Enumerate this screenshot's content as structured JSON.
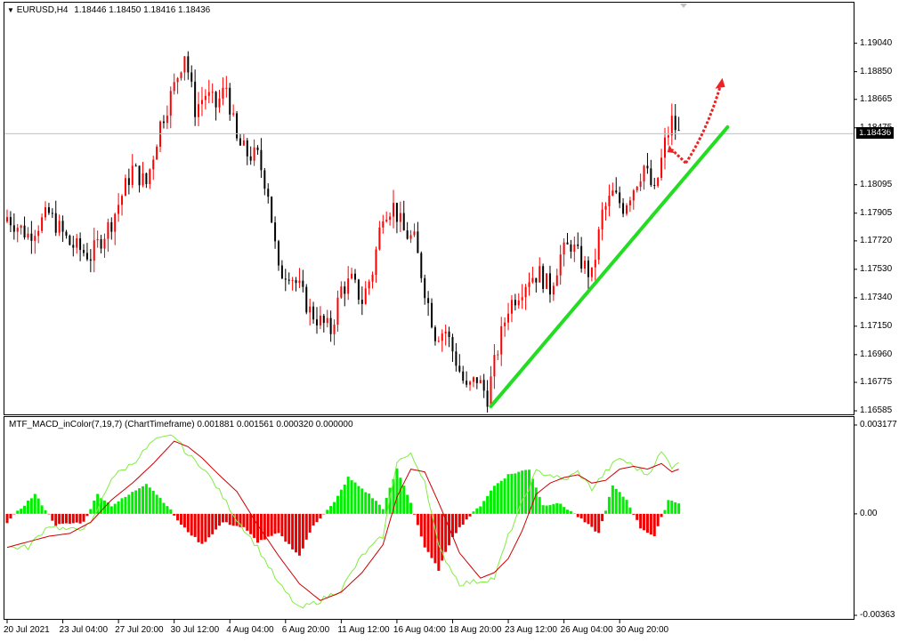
{
  "header": {
    "symbol": "EURUSD,H4",
    "ohlc": "1.18446 1.18450 1.18416 1.18436"
  },
  "indicator": {
    "title": "MTF_MACD_inColor(7,19,7) (ChartTimeframe) 0.001881 0.001561 0.000320 0.000000"
  },
  "price_axis": [
    "1.19040",
    "1.18850",
    "1.18665",
    "1.18475",
    "1.18095",
    "1.17905",
    "1.17720",
    "1.17530",
    "1.17340",
    "1.17150",
    "1.16960",
    "1.16775",
    "1.16585"
  ],
  "current_price": "1.18436",
  "macd_axis": [
    "0.003177",
    "0.00",
    "-0.00363"
  ],
  "time_axis": [
    "20 Jul 2021",
    "23 Jul 04:00",
    "27 Jul 20:00",
    "30 Jul 12:00",
    "4 Aug 04:00",
    "6 Aug 20:00",
    "11 Aug 12:00",
    "16 Aug 04:00",
    "18 Aug 20:00",
    "23 Aug 12:00",
    "26 Aug 04:00",
    "30 Aug 20:00"
  ],
  "colors": {
    "bull": "#ff0000",
    "bear": "#000000",
    "trendline": "#22dd22",
    "hist_up": "#00ee00",
    "hist_down": "#ee0000",
    "macd_line": "#80ee40",
    "signal_line": "#cc0000",
    "projection": "#ee2222"
  },
  "chart_data": [
    {
      "type": "candlestick",
      "title": "EURUSD,H4",
      "ylim": [
        1.16585,
        1.1921
      ],
      "x": "bar index (H4 bars), time_axis gives tick labels every ~16 bars",
      "close_path": [
        [
          0,
          1.1788
        ],
        [
          6,
          1.1776
        ],
        [
          12,
          1.179
        ],
        [
          18,
          1.177
        ],
        [
          24,
          1.1762
        ],
        [
          30,
          1.1785
        ],
        [
          36,
          1.182
        ],
        [
          40,
          1.181
        ],
        [
          44,
          1.185
        ],
        [
          48,
          1.1875
        ],
        [
          51,
          1.1898
        ],
        [
          54,
          1.186
        ],
        [
          57,
          1.187
        ],
        [
          60,
          1.1862
        ],
        [
          63,
          1.1875
        ],
        [
          66,
          1.1838
        ],
        [
          69,
          1.183
        ],
        [
          72,
          1.1828
        ],
        [
          75,
          1.1805
        ],
        [
          78,
          1.175
        ],
        [
          81,
          1.1752
        ],
        [
          84,
          1.174
        ],
        [
          87,
          1.1725
        ],
        [
          90,
          1.1718
        ],
        [
          93,
          1.1712
        ],
        [
          96,
          1.174
        ],
        [
          99,
          1.1745
        ],
        [
          102,
          1.1732
        ],
        [
          105,
          1.1752
        ],
        [
          108,
          1.1792
        ],
        [
          111,
          1.1795
        ],
        [
          114,
          1.1778
        ],
        [
          117,
          1.1772
        ],
        [
          120,
          1.174
        ],
        [
          123,
          1.171
        ],
        [
          126,
          1.1712
        ],
        [
          129,
          1.1692
        ],
        [
          132,
          1.1672
        ],
        [
          135,
          1.168
        ],
        [
          138,
          1.1668
        ],
        [
          141,
          1.17
        ],
        [
          144,
          1.1728
        ],
        [
          147,
          1.1738
        ],
        [
          150,
          1.1748
        ],
        [
          153,
          1.175
        ],
        [
          156,
          1.174
        ],
        [
          159,
          1.1762
        ],
        [
          162,
          1.177
        ],
        [
          165,
          1.1758
        ],
        [
          168,
          1.1748
        ],
        [
          171,
          1.179
        ],
        [
          174,
          1.1803
        ],
        [
          177,
          1.1795
        ],
        [
          180,
          1.1808
        ],
        [
          183,
          1.1822
        ],
        [
          186,
          1.1803
        ],
        [
          189,
          1.1837
        ],
        [
          191,
          1.1852
        ],
        [
          193,
          1.1843
        ]
      ],
      "trendline": [
        [
          139,
          1.16615
        ],
        [
          207,
          1.1848
        ]
      ],
      "projection": [
        [
          191,
          1.1833
        ],
        [
          195,
          1.1824
        ],
        [
          201,
          1.1852
        ],
        [
          205,
          1.1876
        ]
      ],
      "current_price": 1.18436
    },
    {
      "type": "bar",
      "title": "MTF_MACD_inColor(7,19,7) (ChartTimeframe)",
      "ylim": [
        -0.00363,
        0.003177
      ],
      "histogram": [
        [
          0,
          -0.0003
        ],
        [
          8,
          0.0007
        ],
        [
          14,
          -0.0004
        ],
        [
          22,
          -0.0003
        ],
        [
          26,
          0.0007
        ],
        [
          30,
          0.0003
        ],
        [
          34,
          0.0006
        ],
        [
          40,
          0.0011
        ],
        [
          46,
          0.0003
        ],
        [
          50,
          -0.0004
        ],
        [
          56,
          -0.0011
        ],
        [
          62,
          -0.0003
        ],
        [
          68,
          -0.0005
        ],
        [
          72,
          -0.001
        ],
        [
          78,
          -0.0007
        ],
        [
          84,
          -0.0015
        ],
        [
          88,
          -0.0004
        ],
        [
          94,
          0.0004
        ],
        [
          98,
          0.0013
        ],
        [
          104,
          0.0007
        ],
        [
          108,
          0.0002
        ],
        [
          112,
          0.0016
        ],
        [
          116,
          0.0004
        ],
        [
          120,
          -0.0012
        ],
        [
          124,
          -0.002
        ],
        [
          128,
          -0.0008
        ],
        [
          132,
          -0.0002
        ],
        [
          136,
          0.0003
        ],
        [
          140,
          0.001
        ],
        [
          144,
          0.0014
        ],
        [
          150,
          0.0016
        ],
        [
          154,
          0.0003
        ],
        [
          158,
          0.0004
        ],
        [
          162,
          0.0001
        ],
        [
          166,
          -0.0003
        ],
        [
          170,
          -0.0007
        ],
        [
          174,
          0.001
        ],
        [
          178,
          0.0005
        ],
        [
          182,
          -0.0005
        ],
        [
          186,
          -0.0008
        ],
        [
          190,
          0.0005
        ],
        [
          193,
          0.0004
        ]
      ],
      "series": [
        {
          "values": [
            [
              0,
              -0.0012
            ],
            [
              6,
              -0.0012
            ],
            [
              12,
              -0.0004
            ],
            [
              18,
              -0.0006
            ],
            [
              24,
              -0.0004
            ],
            [
              30,
              0.0013
            ],
            [
              36,
              0.0018
            ],
            [
              42,
              0.0026
            ],
            [
              48,
              0.0028
            ],
            [
              52,
              0.0021
            ],
            [
              56,
              0.0017
            ],
            [
              60,
              0.001
            ],
            [
              66,
              -0.0002
            ],
            [
              72,
              -0.0012
            ],
            [
              78,
              -0.0025
            ],
            [
              84,
              -0.0034
            ],
            [
              90,
              -0.0031
            ],
            [
              96,
              -0.0027
            ],
            [
              102,
              -0.0015
            ],
            [
              108,
              -0.0008
            ],
            [
              112,
              0.0019
            ],
            [
              116,
              0.0021
            ],
            [
              120,
              0.0012
            ],
            [
              124,
              -0.0012
            ],
            [
              130,
              -0.0025
            ],
            [
              136,
              -0.0024
            ],
            [
              140,
              -0.0023
            ],
            [
              144,
              -0.0008
            ],
            [
              148,
              0.0004
            ],
            [
              152,
              0.0015
            ],
            [
              156,
              0.0014
            ],
            [
              160,
              0.0012
            ],
            [
              164,
              0.0015
            ],
            [
              168,
              0.0009
            ],
            [
              172,
              0.0015
            ],
            [
              176,
              0.002
            ],
            [
              180,
              0.0017
            ],
            [
              184,
              0.0014
            ],
            [
              188,
              0.0022
            ],
            [
              191,
              0.0017
            ],
            [
              193,
              0.0019
            ]
          ]
        },
        {
          "values": [
            [
              0,
              -0.0012
            ],
            [
              6,
              -0.001
            ],
            [
              12,
              -0.0008
            ],
            [
              18,
              -0.0007
            ],
            [
              24,
              -0.0003
            ],
            [
              30,
              0.0005
            ],
            [
              36,
              0.0011
            ],
            [
              42,
              0.0018
            ],
            [
              48,
              0.0026
            ],
            [
              52,
              0.0024
            ],
            [
              56,
              0.002
            ],
            [
              60,
              0.0015
            ],
            [
              66,
              0.0008
            ],
            [
              72,
              -0.0004
            ],
            [
              78,
              -0.0015
            ],
            [
              84,
              -0.0025
            ],
            [
              90,
              -0.0031
            ],
            [
              96,
              -0.0028
            ],
            [
              102,
              -0.0021
            ],
            [
              108,
              -0.0011
            ],
            [
              112,
              0.0006
            ],
            [
              116,
              0.0016
            ],
            [
              120,
              0.0015
            ],
            [
              124,
              0.0004
            ],
            [
              130,
              -0.0014
            ],
            [
              136,
              -0.0023
            ],
            [
              140,
              -0.0021
            ],
            [
              144,
              -0.0016
            ],
            [
              148,
              -0.0006
            ],
            [
              152,
              0.0007
            ],
            [
              156,
              0.0011
            ],
            [
              160,
              0.0013
            ],
            [
              164,
              0.0014
            ],
            [
              168,
              0.0011
            ],
            [
              172,
              0.0012
            ],
            [
              176,
              0.0016
            ],
            [
              180,
              0.0017
            ],
            [
              184,
              0.0016
            ],
            [
              188,
              0.0018
            ],
            [
              191,
              0.0015
            ],
            [
              193,
              0.0016
            ]
          ]
        }
      ]
    }
  ]
}
